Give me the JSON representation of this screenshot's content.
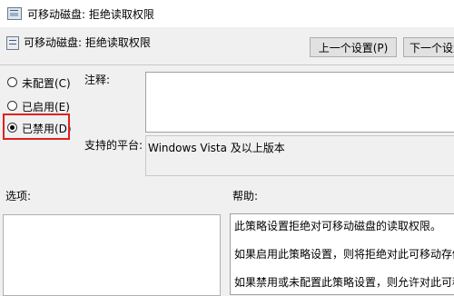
{
  "window": {
    "title": "可移动磁盘: 拒绝读取权限"
  },
  "header": {
    "title": "可移动磁盘: 拒绝读取权限"
  },
  "buttons": {
    "prev": "上一个设置(P)",
    "next": "下一个设置"
  },
  "radio": {
    "not_configured": "未配置(C)",
    "enabled": "已启用(E)",
    "disabled": "已禁用(D)",
    "selected": "disabled"
  },
  "labels": {
    "comment": "注释:",
    "supported": "支持的平台:",
    "options": "选项:",
    "help": "帮助:"
  },
  "comment_value": "",
  "supported_value": "Windows Vista 及以上版本",
  "help_lines": [
    "此策略设置拒绝对可移动磁盘的读取权限。",
    "如果启用此策略设置，则将拒绝对此可移动存储类",
    "如果禁用或未配置此策略设置，则允许对此可移动"
  ],
  "colors": {
    "highlight": "#e02020"
  }
}
